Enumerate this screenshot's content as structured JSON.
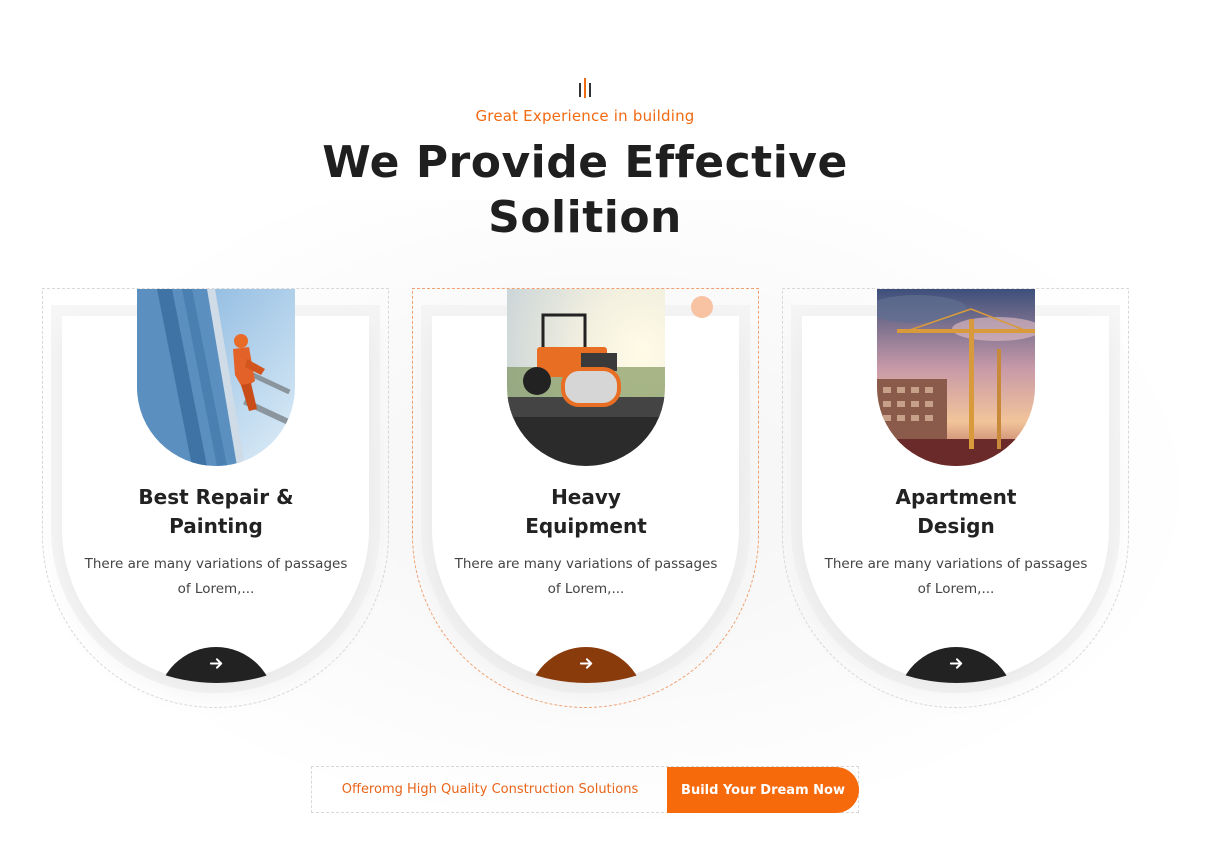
{
  "header": {
    "subtitle": "Great Experience in building",
    "title": "We Provide Effective Solition"
  },
  "services": [
    {
      "title_line1": "Best Repair &",
      "title_line2": "Painting",
      "description": "There are many variations of passages of Lorem,...",
      "image": "worker-painting-building",
      "button_icon": "arrow-right-icon"
    },
    {
      "title_line1": "Heavy",
      "title_line2": "Equipment",
      "description": "There are many variations of passages of Lorem,...",
      "image": "road-roller-asphalt",
      "button_icon": "arrow-right-icon"
    },
    {
      "title_line1": "Apartment",
      "title_line2": "Design",
      "description": "There are many variations of passages of Lorem,...",
      "image": "crane-construction-site",
      "button_icon": "arrow-right-icon"
    }
  ],
  "cta": {
    "text": "Offeromg High Quality Construction Solutions",
    "button_label": "Build Your Dream Now"
  },
  "colors": {
    "accent": "#f76a0c",
    "dark": "#222222",
    "active_button": "#8a3b0c"
  }
}
